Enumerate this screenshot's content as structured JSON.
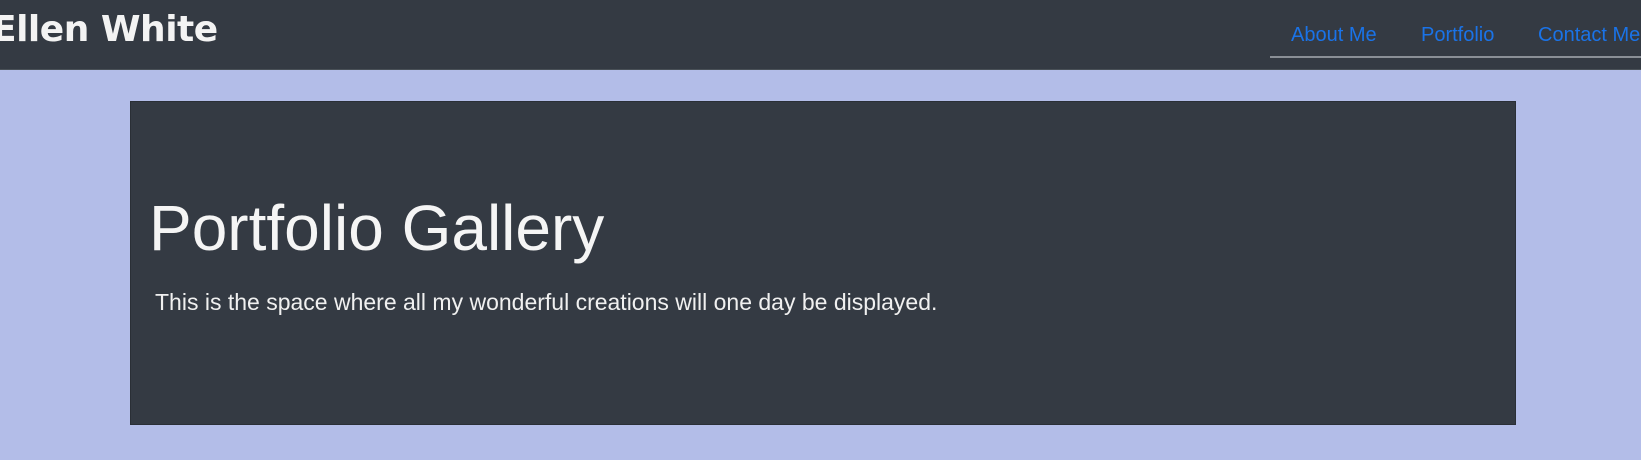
{
  "navbar": {
    "brand": "Ellen White",
    "links": [
      {
        "label": "About Me"
      },
      {
        "label": "Portfolio"
      },
      {
        "label": "Contact Me"
      }
    ]
  },
  "jumbotron": {
    "title": "Portfolio Gallery",
    "lead": "This is the space where all my wonderful creations will one day be displayed."
  },
  "colors": {
    "page_background": "#b3bde8",
    "navbar_background": "#343a43",
    "jumbotron_background": "#343a43",
    "link_color": "#1a73e8",
    "text_color": "#f5f5f5"
  }
}
